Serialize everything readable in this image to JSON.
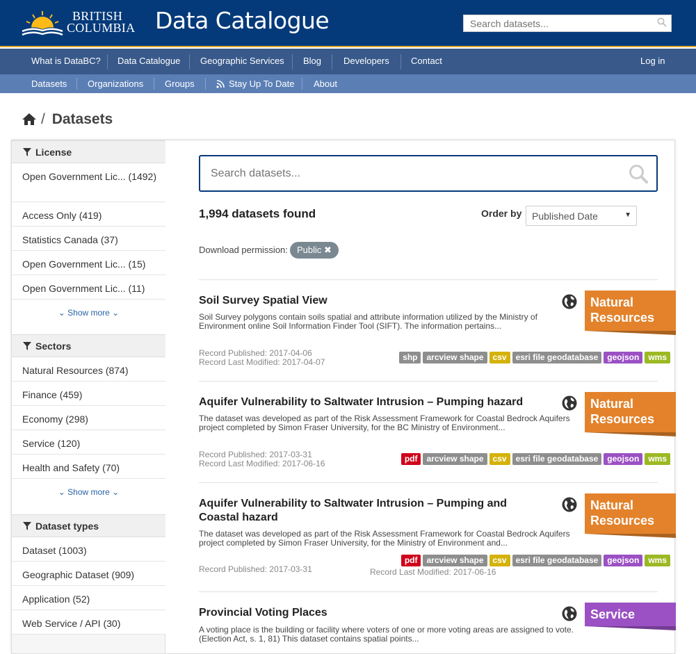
{
  "header": {
    "logo_line1": "BRITISH",
    "logo_line2": "COLUMBIA",
    "site_title": "Data Catalogue",
    "search_placeholder": "Search datasets..."
  },
  "nav_primary": [
    "What is DataBC?",
    "Data Catalogue",
    "Geographic Services",
    "Blog",
    "Developers",
    "Contact"
  ],
  "login": "Log in",
  "nav_secondary": [
    "Datasets",
    "Organizations",
    "Groups",
    "Stay Up To Date",
    "About"
  ],
  "breadcrumb": {
    "sep": "/",
    "current": "Datasets"
  },
  "facets": {
    "license": {
      "title": "License",
      "items": [
        "Open Government Lic... (1492)",
        "Access Only (419)",
        "Statistics Canada (37)",
        "Open Government Lic... (15)",
        "Open Government Lic... (11)"
      ],
      "show_more": "Show more"
    },
    "sectors": {
      "title": "Sectors",
      "items": [
        "Natural Resources (874)",
        "Finance (459)",
        "Economy (298)",
        "Service (120)",
        "Health and Safety (70)"
      ],
      "show_more": "Show more"
    },
    "dataset_types": {
      "title": "Dataset types",
      "items": [
        "Dataset (1003)",
        "Geographic Dataset (909)",
        "Application (52)",
        "Web Service / API (30)"
      ]
    }
  },
  "search": {
    "placeholder": "Search datasets..."
  },
  "results": {
    "count_text": "1,994 datasets found",
    "order_label": "Order by",
    "order_value": "Published Date"
  },
  "filter": {
    "label": "Download permission:",
    "pill": "Public"
  },
  "colors": {
    "header_bg": "#053a7a",
    "nav1_bg": "#38598a",
    "nav2_bg": "#5b7fb5",
    "natural_resources": "#e3822b",
    "service": "#9b51c4"
  },
  "datasets": [
    {
      "title": "Soil Survey Spatial View",
      "desc": "Soil Survey polygons contain soils spatial and attribute information utilized by the Ministry of Environment online Soil Information Finder Tool (SIFT). The information pertains...",
      "published": "Record Published: 2017-04-06",
      "modified": "Record Last Modified: 2017-04-07",
      "sector": "Natural Resources",
      "tags": [
        "shp",
        "arcview shape",
        "csv",
        "esri file geodatabase",
        "geojson",
        "wms"
      ]
    },
    {
      "title": "Aquifer Vulnerability to Saltwater Intrusion – Pumping hazard",
      "desc": "The dataset was developed as part of the Risk Assessment Framework for Coastal Bedrock Aquifers project completed by Simon Fraser University, for the BC Ministry of Environment...",
      "published": "Record Published: 2017-03-31",
      "modified": "Record Last Modified: 2017-06-16",
      "sector": "Natural Resources",
      "tags": [
        "pdf",
        "arcview shape",
        "csv",
        "esri file geodatabase",
        "geojson",
        "wms"
      ]
    },
    {
      "title": "Aquifer Vulnerability to Saltwater Intrusion – Pumping and Coastal hazard",
      "desc": "The dataset was developed as part of the Risk Assessment Framework for Coastal Bedrock Aquifers project completed by Simon Fraser University, for the Ministry of Environment and...",
      "published": "Record Published: 2017-03-31",
      "modified": "Record Last Modified: 2017-06-16",
      "sector": "Natural Resources",
      "tags": [
        "pdf",
        "arcview shape",
        "csv",
        "esri file geodatabase",
        "geojson",
        "wms"
      ]
    },
    {
      "title": "Provincial Voting Places",
      "desc": "A voting place is the building or facility where voters of one or more voting areas are assigned to vote. (Election Act, s. 1, 81) This dataset contains spatial points...",
      "sector": "Service"
    }
  ]
}
